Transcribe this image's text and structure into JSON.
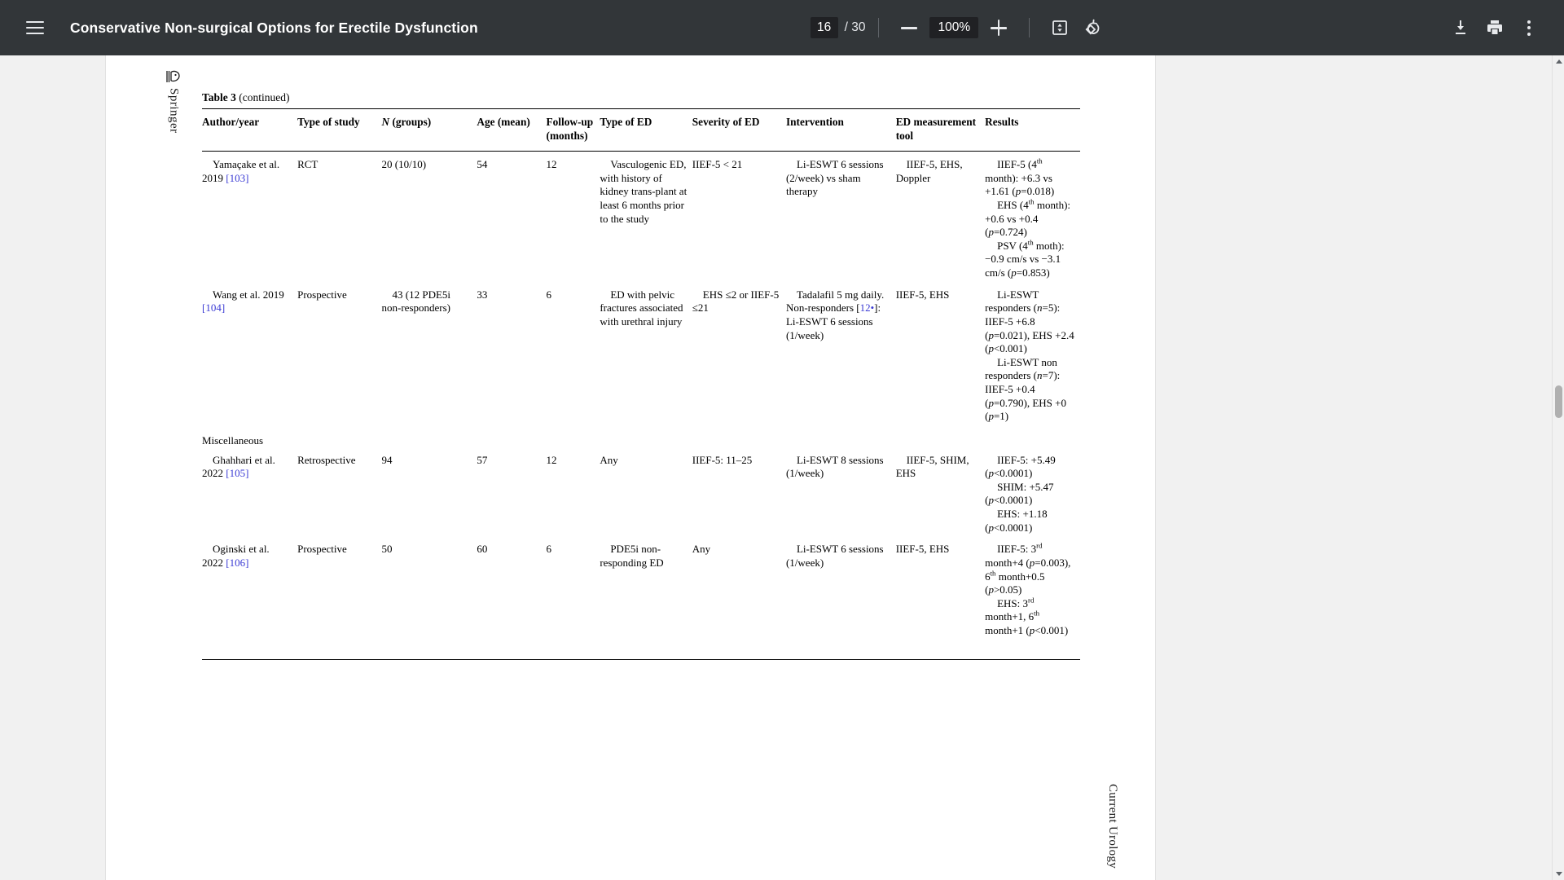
{
  "toolbar": {
    "menu_icon": "hamburger-menu-icon",
    "title": "Conservative Non-surgical Options for Erectile Dysfunction",
    "page_current": "16",
    "page_total": "/ 30",
    "zoom_out_icon": "minus-icon",
    "zoom_level": "100%",
    "zoom_in_icon": "plus-icon",
    "fit_icon": "fit-to-page-icon",
    "rotate_icon": "rotate-counterclockwise-icon",
    "download_icon": "download-icon",
    "print_icon": "print-icon",
    "more_icon": "more-options-kebab-icon"
  },
  "page": {
    "springer_label": "Springer",
    "journal_label": "Current Urology",
    "caption_label": "Table 3",
    "caption_continued": "(continued)"
  },
  "table": {
    "headers": [
      "Author/year",
      "Type of study",
      "N (groups)",
      "Age (mean)",
      "Follow-up (months)",
      "Type of ED",
      "Severity of ED",
      "Intervention",
      "ED measurement tool",
      "Results"
    ],
    "section_label": "Miscellaneous",
    "rows": [
      {
        "author": "Yamaçake et al. 2019",
        "author_ref": "[103]",
        "type_of_study": "RCT",
        "n_groups": "20 (10/10)",
        "age_mean": "54",
        "followup": "12",
        "type_of_ed": "Vasculogenic ED, with history of kidney transplant at least 6 months prior to the study",
        "severity": "IIEF-5 < 21",
        "intervention": "Li-ESWT 6 sessions (2/week) vs sham therapy",
        "tool": "IIEF-5, EHS, Doppler",
        "results": "IIEF-5 (4th month): +6.3 vs +1.61 (p=0.018) EHS (4th month): +0.6 vs +0.4 (p=0.724) PSV (4th moth): -0.9 cm/s vs -3.1 cm/s (p=0.853)"
      },
      {
        "author": "Wang et al. 2019",
        "author_ref": "[104]",
        "type_of_study": "Prospective",
        "n_groups": "43 (12 PDE5i non-responders)",
        "age_mean": "33",
        "followup": "6",
        "type_of_ed": "ED with pelvic fractures associated with urethral injury",
        "severity": "EHS ≤2 or IIEF-5 ≤21",
        "intervention": "Tadalafil 5 mg daily. Non-responders [12•]: Li-ESWT 6 sessions (1/week)",
        "intervention_ref": "12•",
        "tool": "IIEF-5, EHS",
        "results": "Li-ESWT responders (n=5): IIEF-5 +6.8 (p=0.021), EHS +2.4 (p<0.001) Li-ESWT non responders (n=7): IIEF-5 +0.4 (p=0.790), EHS +0 (p=1)"
      },
      {
        "author": "Ghahhari et al. 2022",
        "author_ref": "[105]",
        "type_of_study": "Retrospective",
        "n_groups": "94",
        "age_mean": "57",
        "followup": "12",
        "type_of_ed": "Any",
        "severity": "IIEF-5: 11–25",
        "intervention": "Li-ESWT 8 sessions (1/week)",
        "tool": "IIEF-5, SHIM, EHS",
        "results": "IIEF-5: +5.49 (p<0.0001) SHIM: +5.47 (p<0.0001) EHS: +1.18 (p<0.0001)"
      },
      {
        "author": "Oginski et al. 2022",
        "author_ref": "[106]",
        "type_of_study": "Prospective",
        "n_groups": "50",
        "age_mean": "60",
        "followup": "6",
        "type_of_ed": "PDE5i non-responding ED",
        "severity": "Any",
        "intervention": "Li-ESWT 6 sessions (1/week)",
        "tool": "IIEF-5, EHS",
        "results": "IIEF-5: 3rd month +4 (p=0.003), 6th month +0.5 (p>0.05) EHS: 3rd month +1, 6th month +1 (p<0.001)"
      }
    ]
  },
  "colors": {
    "toolbar_bg": "#323639",
    "toolbar_field_bg": "#202124",
    "viewer_bg": "#f1f1f1",
    "page_bg": "#ffffff",
    "reference_link": "#3b3bd4"
  }
}
